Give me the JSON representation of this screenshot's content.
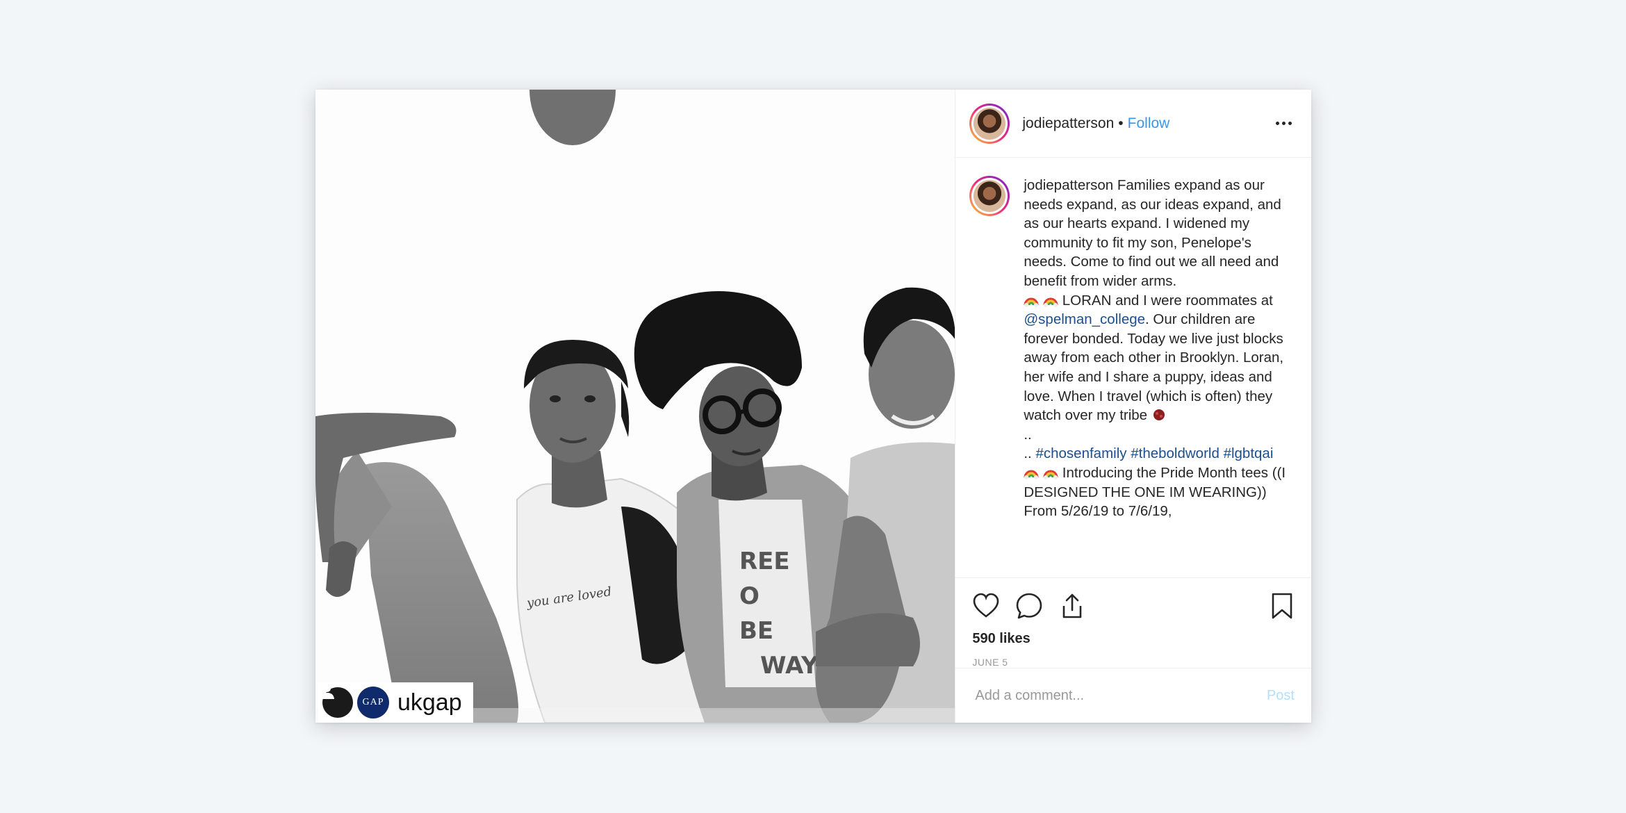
{
  "post": {
    "image_source_tag": {
      "gap_logo_text": "GAP",
      "account": "ukgap"
    }
  },
  "header": {
    "username": "jodiepatterson",
    "separator": "•",
    "follow_label": "Follow"
  },
  "caption": {
    "username": "jodiepatterson",
    "part1": "Families expand as our needs expand, as our ideas expand, and as our hearts expand. I widened my community to fit my son, Penelope's needs. Come to find out we all need and benefit from wider arms.",
    "part2_text": "LORAN and I were roommates at",
    "mention": "@spelman_college",
    "part3": ". Our children are forever bonded. Today we live just blocks away from each other in Brooklyn. Loran, her wife and I share a puppy, ideas and love. When I travel (which is often) they watch over my tribe",
    "dots1": "..",
    "dots2": "..",
    "hashtag1": "#chosenfamily",
    "hashtag2": "#theboldworld",
    "hashtag3": "#lgbtqai",
    "part4": "Introducing the Pride Month tees ((I DESIGNED THE ONE IM WEARING)) From 5/26/19 to 7/6/19,"
  },
  "actions": {
    "likes": "590 likes",
    "date": "JUNE 5"
  },
  "comment": {
    "placeholder": "Add a comment...",
    "post_label": "Post"
  },
  "icons": [
    "more-options-icon",
    "heart-icon",
    "comment-icon",
    "share-icon",
    "bookmark-icon",
    "rainbow-emoji-icon",
    "hug-emoji-icon",
    "user-icon"
  ],
  "colors": {
    "link": "#3897f0",
    "mention": "#1c4f8d",
    "post_disabled": "#b2dffc",
    "meta": "#999999"
  }
}
